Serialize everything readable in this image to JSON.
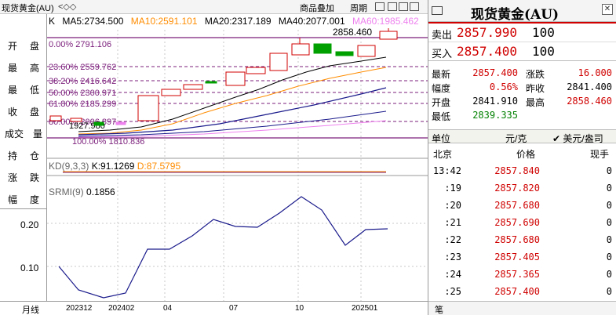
{
  "titlebar": {
    "title": "现货黄金(AU)",
    "nav": "<◇◇",
    "btn_overlay": "商品叠加",
    "btn_period": "周期"
  },
  "left_labels": [
    [
      "开",
      "盘"
    ],
    [
      "最",
      "高"
    ],
    [
      "最",
      "低"
    ],
    [
      "收",
      "盘"
    ],
    [
      "成交",
      "量"
    ],
    [
      "持",
      "仓"
    ],
    [
      "涨",
      "跌"
    ],
    [
      "幅",
      "度"
    ]
  ],
  "legend": {
    "k": "K",
    "ma5": "MA5:2734.500",
    "ma10": "MA10:2591.101",
    "ma20": "MA20:2317.189",
    "ma40": "MA40:2077.001",
    "ma60": "MA60:1985.462"
  },
  "fib_levels": [
    {
      "label": "0.00% 2791.106",
      "color": "#7b1f7b"
    },
    {
      "label": "23.60% 2559.762",
      "color": "#7b1f7b"
    },
    {
      "label": "38.20% 2416.642",
      "color": "#7b1f7b"
    },
    {
      "label": "50.00% 2300.971",
      "color": "#7b1f7b"
    },
    {
      "label": "61.80% 2185.299",
      "color": "#7b1f7b"
    },
    {
      "label": "80.00% 2006.897",
      "color": "#7b1f7b"
    },
    {
      "label": "100.00% 1810.836",
      "color": "#7b1f7b"
    }
  ],
  "high_marker": "2858.460",
  "low_marker": "1927.980",
  "kd_label": "KD(9,3,3)",
  "kd_k": "K:91.1269",
  "kd_d": "D:87.5795",
  "srmi_label": "SRMI(9)",
  "srmi_value": "0.1856",
  "srmi_axis": [
    "0.20",
    "0.10"
  ],
  "bottom": {
    "period": "月线",
    "ticks": [
      "202312",
      "202402",
      "04",
      "07",
      "10",
      "202501"
    ]
  },
  "panel": {
    "title": "现货黄金(AU)",
    "sell_label": "卖出",
    "sell_price": "2857.990",
    "sell_qty": "100",
    "buy_label": "买入",
    "buy_price": "2857.400",
    "buy_qty": "100",
    "stats": [
      {
        "k1": "最新",
        "v1": "2857.400",
        "c1": "#d00000",
        "k2": "涨跌",
        "v2": "16.000",
        "c2": "#d00000"
      },
      {
        "k1": "幅度",
        "v1": "0.56%",
        "c1": "#d00000",
        "k2": "昨收",
        "v2": "2841.400",
        "c2": "#000000"
      },
      {
        "k1": "开盘",
        "v1": "2841.910",
        "c1": "#000000",
        "k2": "最高",
        "v2": "2858.460",
        "c2": "#d00000"
      },
      {
        "k1": "最低",
        "v1": "2839.335",
        "c1": "#008000",
        "k2": "",
        "v2": "",
        "c2": "#000000"
      }
    ],
    "unit_label": "单位",
    "unit_value": "元/克",
    "unit_check": "✔ 美元/盎司",
    "ticks_head": {
      "time": "北京",
      "price": "价格",
      "qty": "现手"
    },
    "ticks": [
      {
        "t": "13:42",
        "p": "2857.840",
        "q": "0"
      },
      {
        "t": ":19",
        "p": "2857.820",
        "q": "0"
      },
      {
        "t": ":20",
        "p": "2857.680",
        "q": "0"
      },
      {
        "t": ":21",
        "p": "2857.690",
        "q": "0"
      },
      {
        "t": ":22",
        "p": "2857.680",
        "q": "0"
      },
      {
        "t": ":23",
        "p": "2857.405",
        "q": "0"
      },
      {
        "t": ":24",
        "p": "2857.365",
        "q": "0"
      },
      {
        "t": ":25",
        "p": "2857.400",
        "q": "0"
      }
    ],
    "bottom_tab": "笔"
  },
  "colors": {
    "up": "#d00000",
    "down": "#008000",
    "ma5": "#000000",
    "ma10": "#ff8c00",
    "ma20": "#1a1a8c",
    "ma40": "#ee82ee",
    "ma60": "#ff69b4"
  }
}
